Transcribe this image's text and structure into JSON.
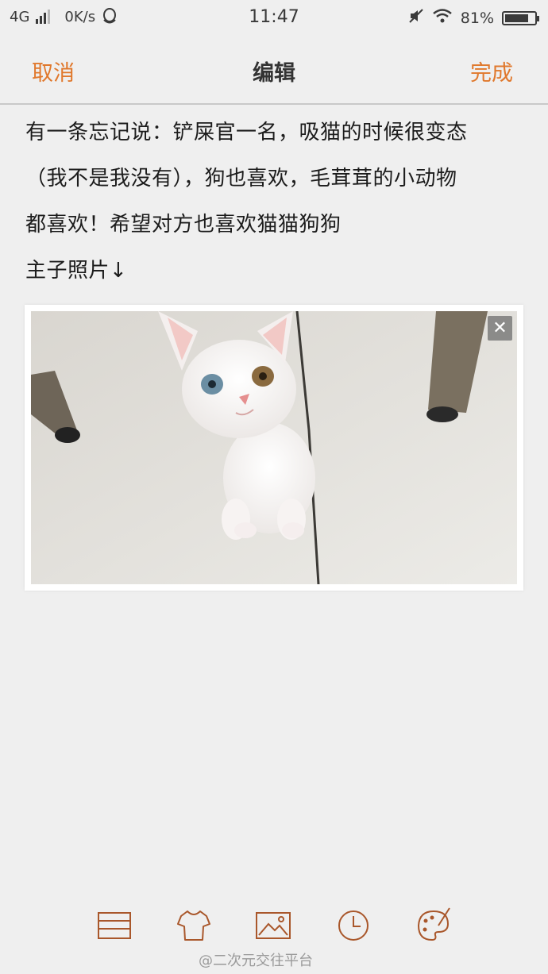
{
  "status_bar": {
    "network": "4G",
    "speed": "0K/s",
    "time": "11:47",
    "battery": "81%",
    "battery_level": 0.81
  },
  "header": {
    "cancel_label": "取消",
    "title": "编辑",
    "done_label": "完成"
  },
  "note": {
    "lines": [
      "有一条忘记说：铲屎官一名，吸猫的时候很变态",
      "（我不是我没有），狗也喜欢，毛茸茸的小动物",
      "都喜欢！希望对方也喜欢猫猫狗狗",
      "主子照片↓"
    ]
  },
  "photo": {
    "close_label": "✕",
    "subject": "white-kitten-photo"
  },
  "toolbar": {
    "icons": [
      "list-icon",
      "shirt-icon",
      "image-icon",
      "clock-icon",
      "palette-icon"
    ]
  },
  "watermark": "@二次元交往平台",
  "colors": {
    "accent": "#e0782c",
    "background": "#efefef",
    "icon": "#a9572b"
  }
}
